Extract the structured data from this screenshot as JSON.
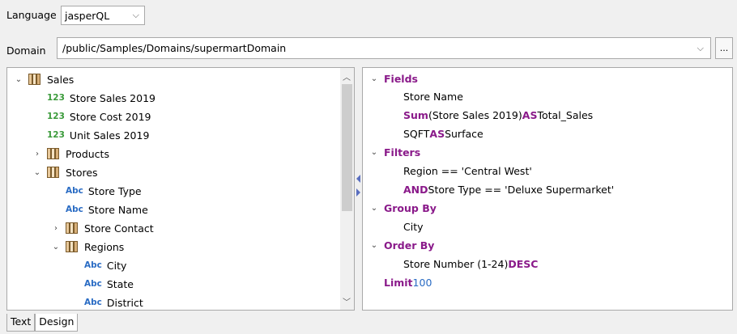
{
  "language": {
    "label": "Language",
    "value": "jasperQL"
  },
  "domain": {
    "label": "Domain",
    "value": "/public/Samples/Domains/supermartDomain",
    "browse": "..."
  },
  "tree": [
    {
      "indent": 0,
      "toggle": "⌄",
      "icon": "folder",
      "label": "Sales"
    },
    {
      "indent": 1,
      "toggle": "",
      "icon": "123",
      "label": "Store Sales 2019"
    },
    {
      "indent": 1,
      "toggle": "",
      "icon": "123",
      "label": "Store Cost 2019"
    },
    {
      "indent": 1,
      "toggle": "",
      "icon": "123",
      "label": "Unit Sales 2019"
    },
    {
      "indent": 1,
      "toggle": "›",
      "icon": "folder",
      "label": "Products"
    },
    {
      "indent": 1,
      "toggle": "⌄",
      "icon": "folder",
      "label": "Stores"
    },
    {
      "indent": 2,
      "toggle": "",
      "icon": "Abc",
      "label": "Store Type"
    },
    {
      "indent": 2,
      "toggle": "",
      "icon": "Abc",
      "label": "Store Name"
    },
    {
      "indent": 2,
      "toggle": "›",
      "icon": "folder",
      "label": "Store Contact"
    },
    {
      "indent": 2,
      "toggle": "⌄",
      "icon": "folder",
      "label": "Regions"
    },
    {
      "indent": 3,
      "toggle": "",
      "icon": "Abc",
      "label": "City"
    },
    {
      "indent": 3,
      "toggle": "",
      "icon": "Abc",
      "label": "State"
    },
    {
      "indent": 3,
      "toggle": "",
      "icon": "Abc",
      "label": "District"
    }
  ],
  "query": {
    "fields_title": "Fields",
    "field1": "Store Name",
    "field2_kw": "Sum",
    "field2_mid": "(Store Sales 2019) ",
    "field2_as": "AS",
    "field2_alias": " Total_Sales",
    "field3_pre": "SQFT ",
    "field3_as": "AS",
    "field3_alias": " Surface",
    "filters_title": "Filters",
    "filter1": "Region == 'Central West'",
    "filter2_and": "AND",
    "filter2_rest": " Store Type == 'Deluxe Supermarket'",
    "groupby_title": "Group By",
    "group1": "City",
    "orderby_title": "Order By",
    "order1_pre": "Store Number (1-24) ",
    "order1_desc": "DESC",
    "limit_kw": "Limit",
    "limit_val": " 100"
  },
  "tabs": [
    "Text",
    "Design"
  ]
}
